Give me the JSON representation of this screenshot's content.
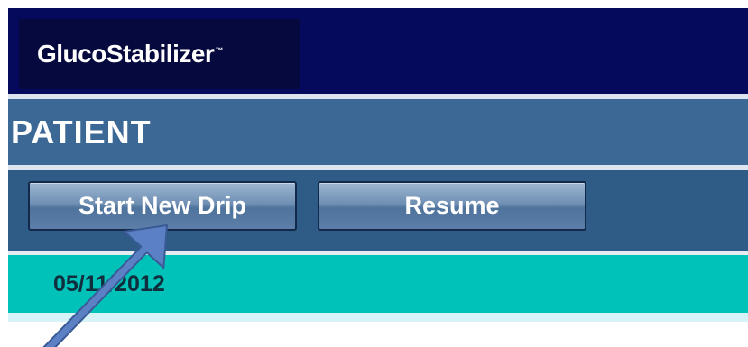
{
  "app": {
    "logo_text": "GlucoStabilizer",
    "logo_trademark": "™"
  },
  "section": {
    "title": "PATIENT"
  },
  "actions": {
    "start_new_drip_label": "Start New Drip",
    "resume_label": "Resume"
  },
  "record": {
    "date": "05/11/2012"
  },
  "colors": {
    "header_bg": "#050a5c",
    "title_bar_bg": "#3c6895",
    "button_bar_bg": "#2f5b87",
    "date_row_bg": "#00c2b8",
    "annotation_arrow": "#5b80c4"
  },
  "icons": {
    "annotation": "pointer-arrow-icon"
  }
}
